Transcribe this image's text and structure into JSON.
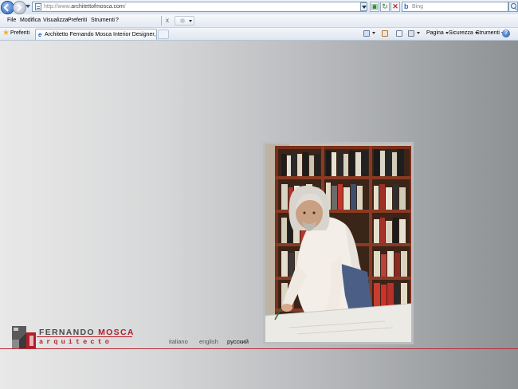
{
  "browser": {
    "address": {
      "scheme": "http://www.",
      "domain": "architettofmosca.com",
      "path": "/"
    },
    "search_placeholder": "Bing",
    "menu": [
      "File",
      "Modifica",
      "Visualizza",
      "Preferiti",
      "Strumenti",
      "?"
    ],
    "close_label": "x",
    "favorites_label": "Preferiti",
    "tab_title": "Architetto Fernando Mosca Interior Designer, Milano, ...",
    "commands": {
      "page": "Pagina",
      "safety": "Sicurezza",
      "tools": "Strumenti"
    },
    "help_glyph": "?"
  },
  "site": {
    "logo": {
      "name_first": "FERNANDO ",
      "name_last": "MOSCA",
      "subtitle": "arquitecto"
    },
    "languages": [
      {
        "label": "italiano",
        "selected": false
      },
      {
        "label": "english",
        "selected": false
      },
      {
        "label": "русский",
        "selected": true
      }
    ]
  },
  "colors": {
    "brand_red": "#b01e2a",
    "logo_gray": "#4a4a4a",
    "link_red_line": "#b5303a"
  },
  "icons": [
    "back-icon",
    "forward-icon",
    "page-icon",
    "refresh-icon",
    "stop-icon",
    "bing-icon",
    "search-icon",
    "star-icon",
    "ie-icon",
    "home-icon",
    "feeds-icon",
    "mail-icon",
    "print-icon",
    "help-icon"
  ]
}
